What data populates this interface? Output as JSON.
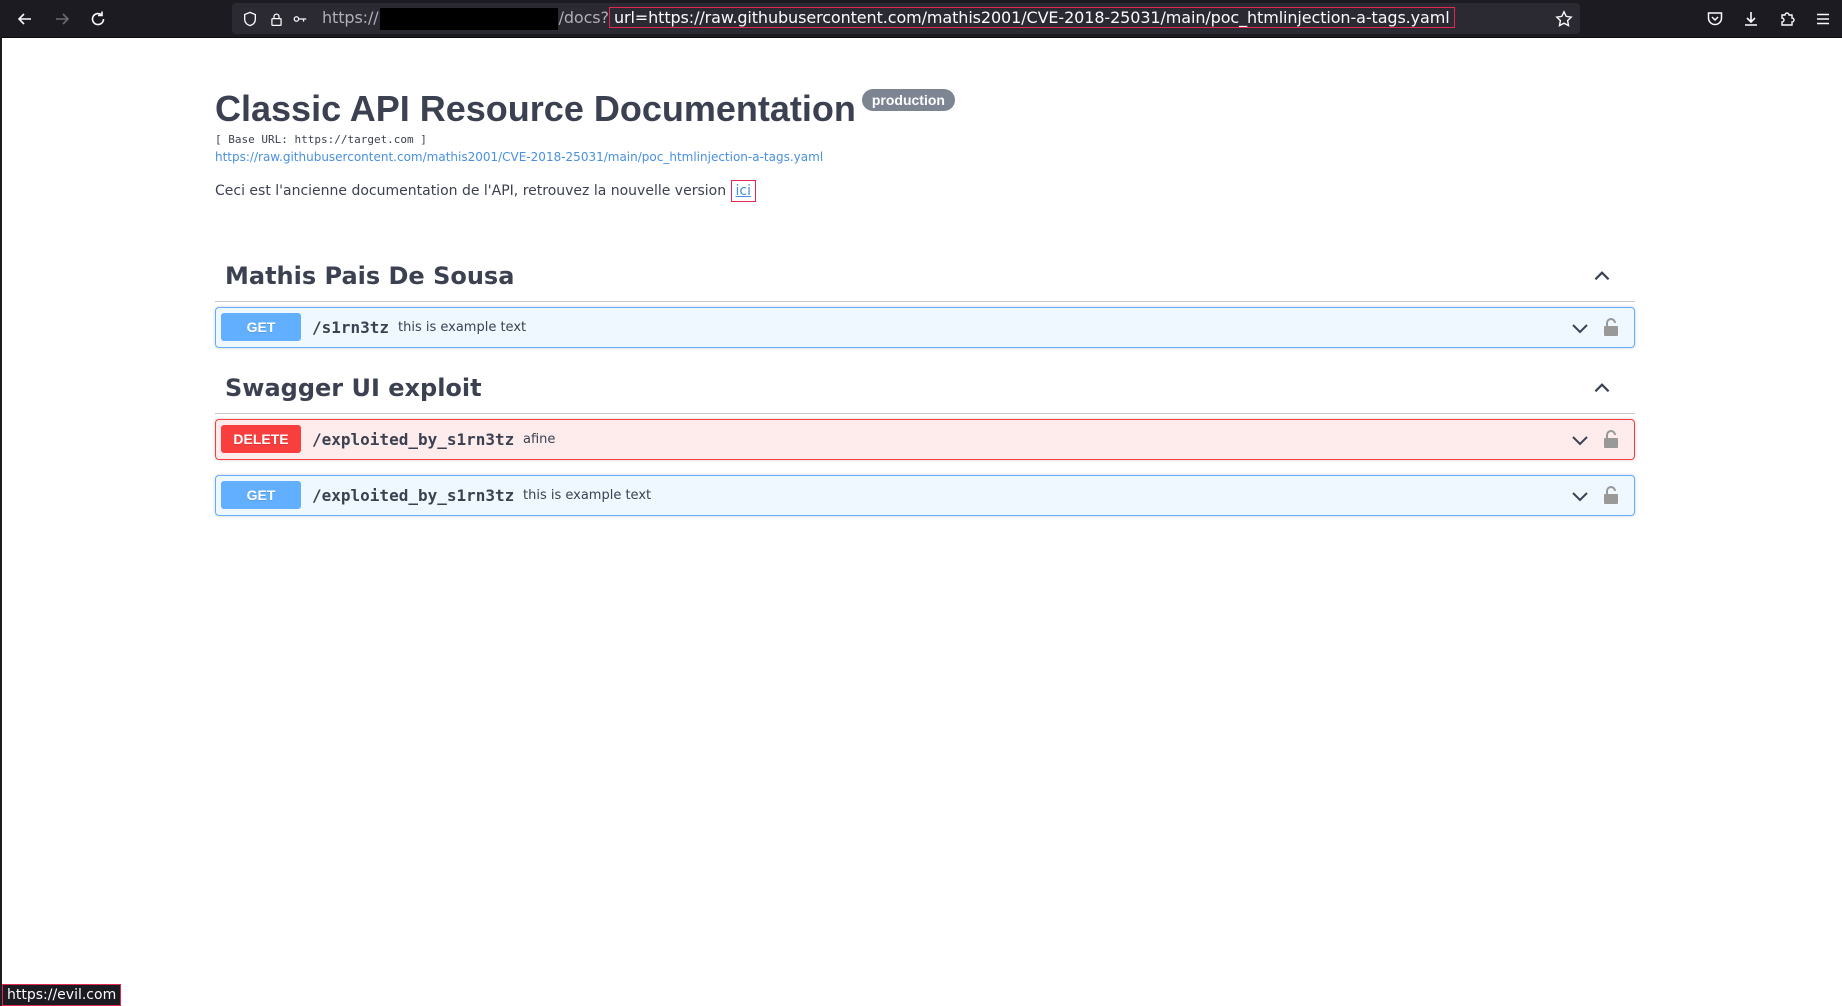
{
  "browser": {
    "url_scheme": "https://",
    "url_path": "/docs?",
    "url_query": "url=https://raw.githubusercontent.com/mathis2001/CVE-2018-25031/main/poc_htmlinjection-a-tags.yaml",
    "status_url": "https://evil.com",
    "colors": {
      "chrome": "#1c1b22",
      "urlbar": "#2b2a33",
      "highlight": "#e22850"
    }
  },
  "info": {
    "title": "Classic API Resource Documentation",
    "badge": "production",
    "base_url": "[ Base URL: https://target.com ]",
    "spec_url": "https://raw.githubusercontent.com/mathis2001/CVE-2018-25031/main/poc_htmlinjection-a-tags.yaml",
    "description_prefix": "Ceci est l'ancienne documentation de l'API, retrouvez la nouvelle version ",
    "description_link": "ici"
  },
  "tags": [
    {
      "name": "Mathis Pais De Sousa",
      "operations": [
        {
          "method": "GET",
          "path": "/s1rn3tz",
          "summary": "this is example text"
        }
      ]
    },
    {
      "name": "Swagger UI exploit",
      "operations": [
        {
          "method": "DELETE",
          "path": "/exploited_by_s1rn3tz",
          "summary": "afine"
        },
        {
          "method": "GET",
          "path": "/exploited_by_s1rn3tz",
          "summary": "this is example text"
        }
      ]
    }
  ],
  "icons": [
    "back-icon",
    "forward-icon",
    "reload-icon",
    "shield-icon",
    "lock-icon",
    "permissions-icon",
    "bookmark-star-icon",
    "pocket-icon",
    "download-icon",
    "extensions-icon",
    "menu-icon",
    "chevron-up-icon",
    "chevron-down-icon",
    "padlock-icon"
  ],
  "method_colors": {
    "GET": "#61affe",
    "DELETE": "#f93e3e"
  }
}
